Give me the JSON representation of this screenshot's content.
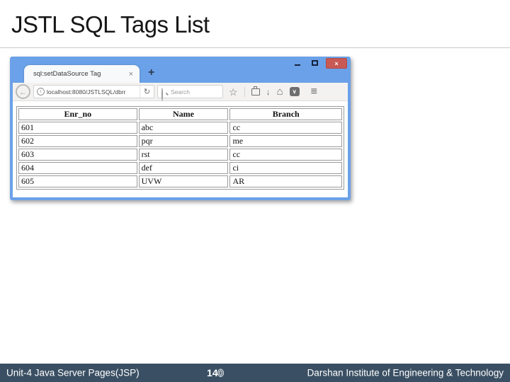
{
  "slide": {
    "title": "JSTL SQL Tags List"
  },
  "footer": {
    "course": "Unit-4 Java Server Pages(JSP)",
    "page_number_prefix": "14",
    "page_number_suffix": "0",
    "institute": "Darshan Institute of Engineering & Technology"
  },
  "browser": {
    "tab_title": "sql:setDataSource Tag",
    "url": "localhost:8080/JSTLSQL/dbrr",
    "search_placeholder": "Search",
    "icons": {
      "close": "×",
      "tab_close": "×",
      "new_tab": "+",
      "back": "←",
      "info": "i",
      "reload": "↻",
      "star": "☆",
      "download": "↓",
      "home": "⌂",
      "pocket_chevron": "∨",
      "menu": "≡"
    },
    "table": {
      "headers": [
        "Enr_no",
        "Name",
        "Branch"
      ],
      "rows": [
        [
          "601",
          "abc",
          "cc"
        ],
        [
          "602",
          "pqr",
          "me"
        ],
        [
          "603",
          "rst",
          "cc"
        ],
        [
          "604",
          "def",
          "ci"
        ],
        [
          "605",
          "UVW",
          "AR"
        ]
      ]
    }
  },
  "colors": {
    "browser_chrome": "#6ba1e8",
    "close_button": "#c85954",
    "footer_bg": "#3a4f63",
    "table_border": "#9a9a9a"
  }
}
